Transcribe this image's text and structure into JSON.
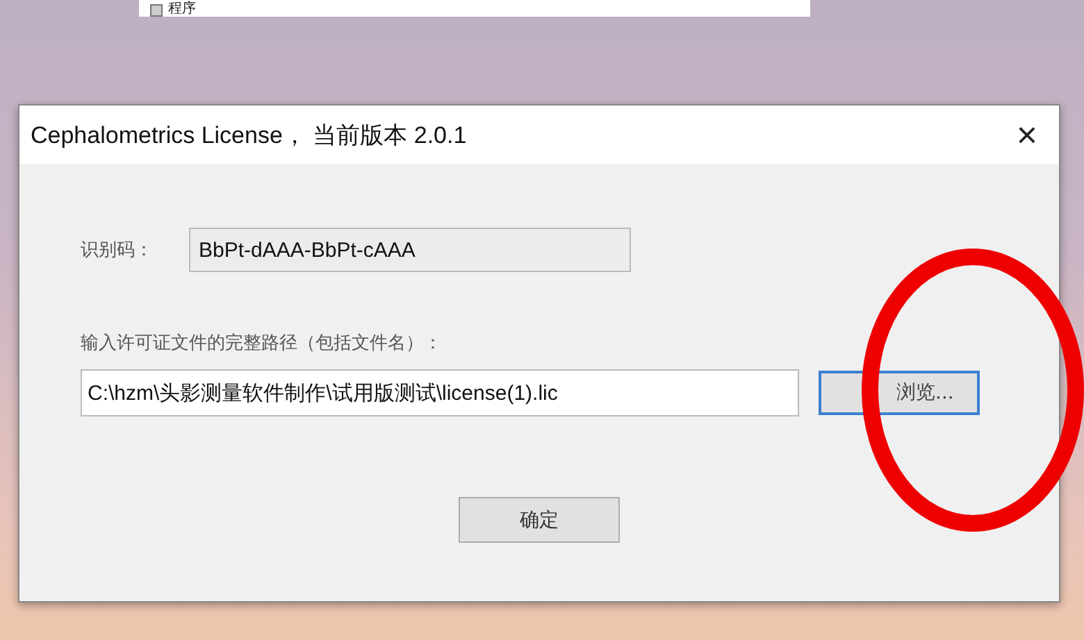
{
  "desktop": {
    "top_label": "程序"
  },
  "dialog": {
    "title": "Cephalometrics License， 当前版本 2.0.1",
    "close": "×",
    "id_label": "识别码：",
    "id_value": "BbPt-dAAA-BbPt-cAAA",
    "path_label": "输入许可证文件的完整路径（包括文件名）：",
    "path_value": "C:\\hzm\\头影测量软件制作\\试用版测试\\license(1).lic",
    "browse_button": {
      "label": "浏览...",
      "focused": true
    },
    "ok_button": "确定"
  },
  "annotation": {
    "kind": "circle",
    "color": "#ee0000"
  }
}
